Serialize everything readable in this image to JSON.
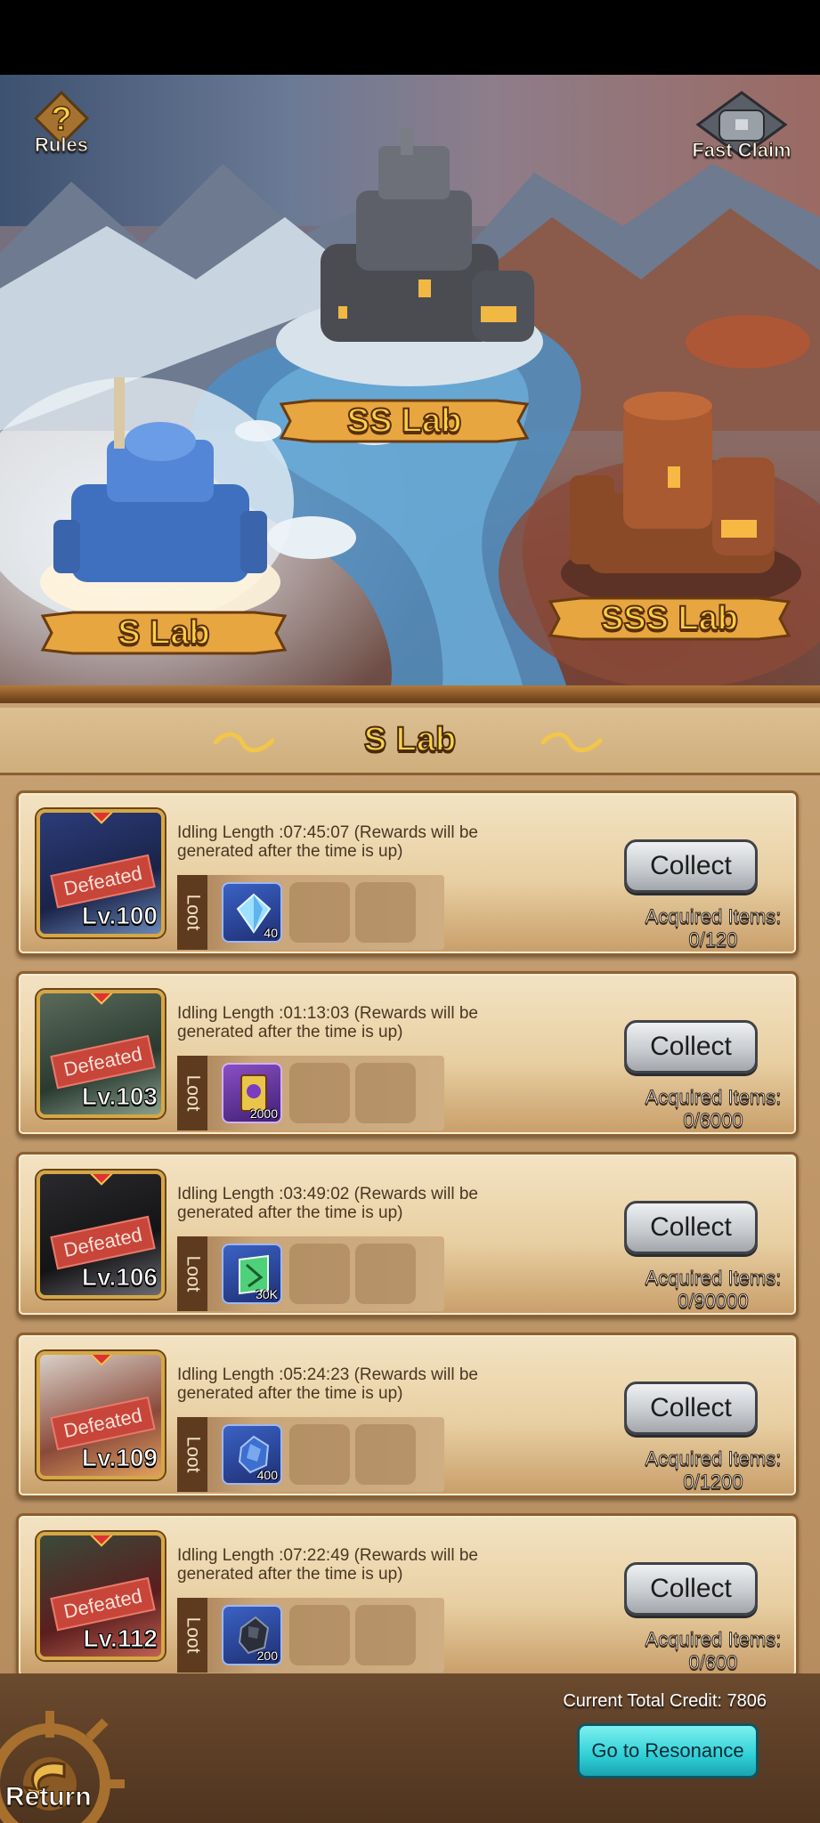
{
  "map": {
    "rules_label": "Rules",
    "fast_claim_label": "Fast Claim",
    "labs": {
      "ss": "SS Lab",
      "s": "S Lab",
      "sss": "SSS Lab"
    }
  },
  "panel": {
    "title": "S Lab",
    "loot_label": "Loot",
    "collect_label": "Collect",
    "acquired_label": "Acquired Items:",
    "defeated_label": "Defeated",
    "cards": [
      {
        "level": "Lv.100",
        "idle_text": "Idling Length :07:45:07 (Rewards will be generated after the time is up)",
        "item_qty": "40",
        "item_icon": "blue-crystal-icon",
        "acquired": "0/120"
      },
      {
        "level": "Lv.103",
        "idle_text": "Idling Length :01:13:03 (Rewards will be generated after the time is up)",
        "item_qty": "2000",
        "item_icon": "purple-card-icon",
        "acquired": "0/6000"
      },
      {
        "level": "Lv.106",
        "idle_text": "Idling Length :03:49:02 (Rewards will be generated after the time is up)",
        "item_qty": "30K",
        "item_icon": "green-ticket-icon",
        "acquired": "0/90000"
      },
      {
        "level": "Lv.109",
        "idle_text": "Idling Length :05:24:23 (Rewards will be generated after the time is up)",
        "item_qty": "400",
        "item_icon": "blue-ore-icon",
        "acquired": "0/1200"
      },
      {
        "level": "Lv.112",
        "idle_text": "Idling Length :07:22:49 (Rewards will be generated after the time is up)",
        "item_qty": "200",
        "item_icon": "dark-ore-icon",
        "acquired": "0/600"
      }
    ]
  },
  "footer": {
    "credit_text": "Current Total Credit: 7806",
    "resonance_label": "Go to Resonance",
    "return_label": "Return"
  },
  "colors": {
    "title_gold": "#f6d24c",
    "panel_brown": "#b68d5f",
    "resonance_cyan": "#2fcfd6",
    "defeated_red": "#c8453a"
  }
}
